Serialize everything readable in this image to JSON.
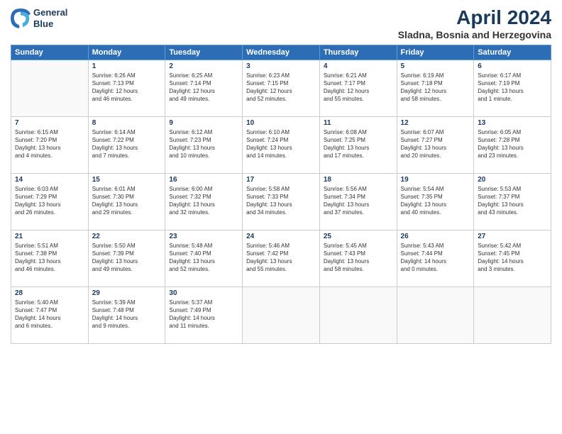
{
  "logo": {
    "line1": "General",
    "line2": "Blue"
  },
  "title": "April 2024",
  "subtitle": "Sladna, Bosnia and Herzegovina",
  "days_of_week": [
    "Sunday",
    "Monday",
    "Tuesday",
    "Wednesday",
    "Thursday",
    "Friday",
    "Saturday"
  ],
  "weeks": [
    [
      {
        "day": "",
        "info": ""
      },
      {
        "day": "1",
        "info": "Sunrise: 6:26 AM\nSunset: 7:13 PM\nDaylight: 12 hours\nand 46 minutes."
      },
      {
        "day": "2",
        "info": "Sunrise: 6:25 AM\nSunset: 7:14 PM\nDaylight: 12 hours\nand 49 minutes."
      },
      {
        "day": "3",
        "info": "Sunrise: 6:23 AM\nSunset: 7:15 PM\nDaylight: 12 hours\nand 52 minutes."
      },
      {
        "day": "4",
        "info": "Sunrise: 6:21 AM\nSunset: 7:17 PM\nDaylight: 12 hours\nand 55 minutes."
      },
      {
        "day": "5",
        "info": "Sunrise: 6:19 AM\nSunset: 7:18 PM\nDaylight: 12 hours\nand 58 minutes."
      },
      {
        "day": "6",
        "info": "Sunrise: 6:17 AM\nSunset: 7:19 PM\nDaylight: 13 hours\nand 1 minute."
      }
    ],
    [
      {
        "day": "7",
        "info": "Sunrise: 6:15 AM\nSunset: 7:20 PM\nDaylight: 13 hours\nand 4 minutes."
      },
      {
        "day": "8",
        "info": "Sunrise: 6:14 AM\nSunset: 7:22 PM\nDaylight: 13 hours\nand 7 minutes."
      },
      {
        "day": "9",
        "info": "Sunrise: 6:12 AM\nSunset: 7:23 PM\nDaylight: 13 hours\nand 10 minutes."
      },
      {
        "day": "10",
        "info": "Sunrise: 6:10 AM\nSunset: 7:24 PM\nDaylight: 13 hours\nand 14 minutes."
      },
      {
        "day": "11",
        "info": "Sunrise: 6:08 AM\nSunset: 7:25 PM\nDaylight: 13 hours\nand 17 minutes."
      },
      {
        "day": "12",
        "info": "Sunrise: 6:07 AM\nSunset: 7:27 PM\nDaylight: 13 hours\nand 20 minutes."
      },
      {
        "day": "13",
        "info": "Sunrise: 6:05 AM\nSunset: 7:28 PM\nDaylight: 13 hours\nand 23 minutes."
      }
    ],
    [
      {
        "day": "14",
        "info": "Sunrise: 6:03 AM\nSunset: 7:29 PM\nDaylight: 13 hours\nand 26 minutes."
      },
      {
        "day": "15",
        "info": "Sunrise: 6:01 AM\nSunset: 7:30 PM\nDaylight: 13 hours\nand 29 minutes."
      },
      {
        "day": "16",
        "info": "Sunrise: 6:00 AM\nSunset: 7:32 PM\nDaylight: 13 hours\nand 32 minutes."
      },
      {
        "day": "17",
        "info": "Sunrise: 5:58 AM\nSunset: 7:33 PM\nDaylight: 13 hours\nand 34 minutes."
      },
      {
        "day": "18",
        "info": "Sunrise: 5:56 AM\nSunset: 7:34 PM\nDaylight: 13 hours\nand 37 minutes."
      },
      {
        "day": "19",
        "info": "Sunrise: 5:54 AM\nSunset: 7:35 PM\nDaylight: 13 hours\nand 40 minutes."
      },
      {
        "day": "20",
        "info": "Sunrise: 5:53 AM\nSunset: 7:37 PM\nDaylight: 13 hours\nand 43 minutes."
      }
    ],
    [
      {
        "day": "21",
        "info": "Sunrise: 5:51 AM\nSunset: 7:38 PM\nDaylight: 13 hours\nand 46 minutes."
      },
      {
        "day": "22",
        "info": "Sunrise: 5:50 AM\nSunset: 7:39 PM\nDaylight: 13 hours\nand 49 minutes."
      },
      {
        "day": "23",
        "info": "Sunrise: 5:48 AM\nSunset: 7:40 PM\nDaylight: 13 hours\nand 52 minutes."
      },
      {
        "day": "24",
        "info": "Sunrise: 5:46 AM\nSunset: 7:42 PM\nDaylight: 13 hours\nand 55 minutes."
      },
      {
        "day": "25",
        "info": "Sunrise: 5:45 AM\nSunset: 7:43 PM\nDaylight: 13 hours\nand 58 minutes."
      },
      {
        "day": "26",
        "info": "Sunrise: 5:43 AM\nSunset: 7:44 PM\nDaylight: 14 hours\nand 0 minutes."
      },
      {
        "day": "27",
        "info": "Sunrise: 5:42 AM\nSunset: 7:45 PM\nDaylight: 14 hours\nand 3 minutes."
      }
    ],
    [
      {
        "day": "28",
        "info": "Sunrise: 5:40 AM\nSunset: 7:47 PM\nDaylight: 14 hours\nand 6 minutes."
      },
      {
        "day": "29",
        "info": "Sunrise: 5:39 AM\nSunset: 7:48 PM\nDaylight: 14 hours\nand 9 minutes."
      },
      {
        "day": "30",
        "info": "Sunrise: 5:37 AM\nSunset: 7:49 PM\nDaylight: 14 hours\nand 11 minutes."
      },
      {
        "day": "",
        "info": ""
      },
      {
        "day": "",
        "info": ""
      },
      {
        "day": "",
        "info": ""
      },
      {
        "day": "",
        "info": ""
      }
    ]
  ]
}
